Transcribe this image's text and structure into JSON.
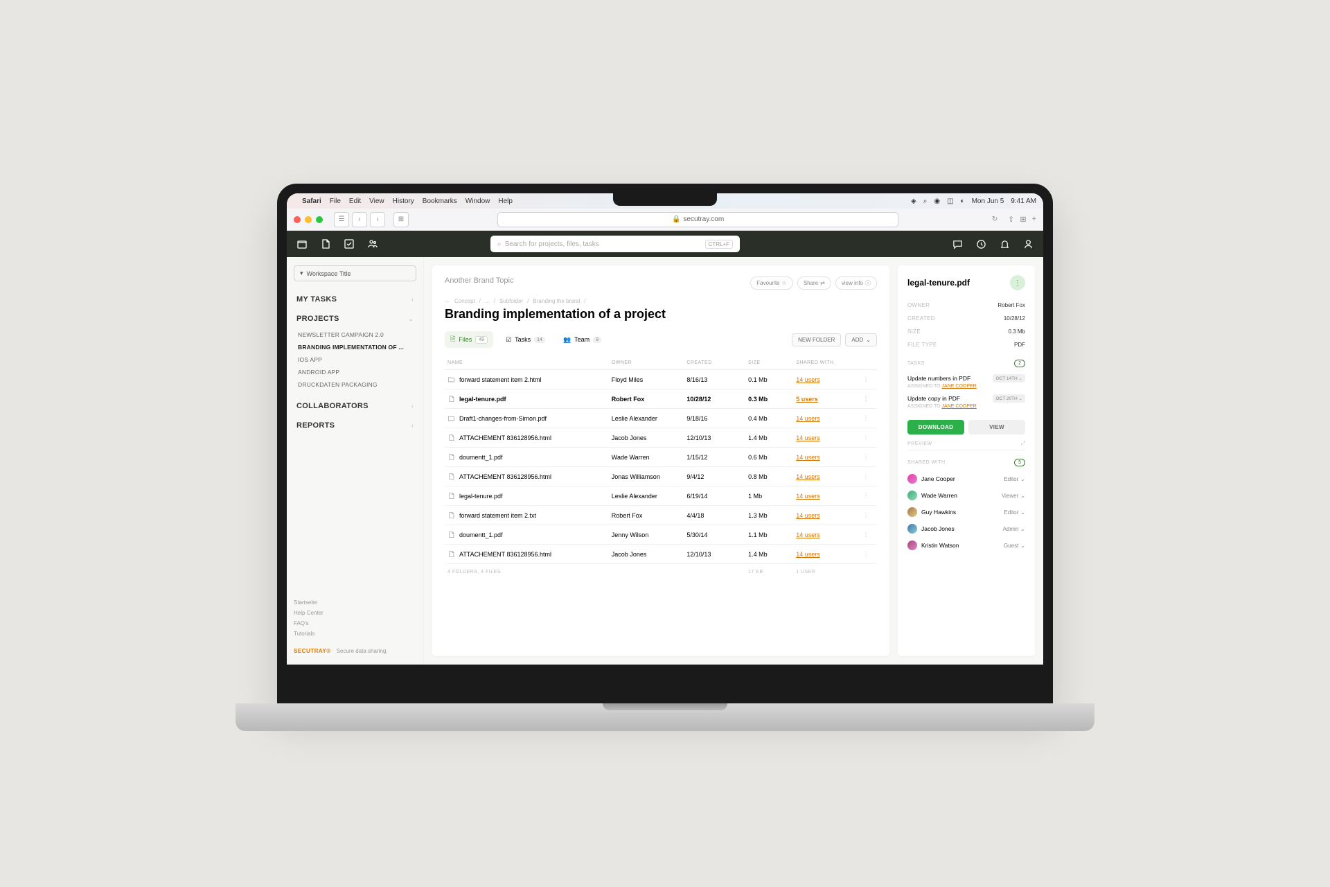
{
  "mac_menubar": {
    "app": "Safari",
    "items": [
      "File",
      "Edit",
      "View",
      "History",
      "Bookmarks",
      "Window",
      "Help"
    ],
    "date": "Mon Jun 5",
    "time": "9:41 AM"
  },
  "safari": {
    "url": "secutray.com"
  },
  "header": {
    "search_placeholder": "Search for projects, files, tasks",
    "search_kbd": "CTRL+F"
  },
  "sidebar": {
    "workspace": "Workspace Title",
    "sections": {
      "my_tasks": "MY TASKS",
      "projects": "PROJECTS",
      "collaborators": "COLLABORATORS",
      "reports": "REPORTS"
    },
    "projects": [
      "NEWSLETTER CAMPAIGN 2.0",
      "BRANDING IMPLEMENTATION OF ...",
      "IOS APP",
      "ANDROID APP",
      "DRUCKDATEN PACKAGING"
    ],
    "footer": {
      "items": [
        "Startseite",
        "Help Center",
        "FAQ's",
        "Tutorials"
      ]
    },
    "brand": "SECUTRAY®",
    "brand_tag": "Secure data sharing."
  },
  "content": {
    "topic": "Another Brand Topic",
    "actions": {
      "favourite": "Favourite",
      "share": "Share",
      "view_info": "view info"
    },
    "breadcrumb": [
      "Concept",
      "...",
      "Subfolder",
      "Branding the brand"
    ],
    "title": "Branding implementation of a project",
    "tabs": {
      "files": {
        "label": "Files",
        "count": "49"
      },
      "tasks": {
        "label": "Tasks",
        "count": "14"
      },
      "team": {
        "label": "Team",
        "count": "8"
      }
    },
    "buttons": {
      "new_folder": "NEW FOLDER",
      "add": "ADD"
    },
    "table": {
      "headers": [
        "NAME",
        "OWNER",
        "CREATED",
        "SIZE",
        "SHARED WITH"
      ],
      "rows": [
        {
          "type": "folder",
          "name": "forward statement item 2.html",
          "owner": "Floyd Miles",
          "created": "8/16/13",
          "size": "0.1 Mb",
          "shared": "14 users"
        },
        {
          "type": "file",
          "name": "legal-tenure.pdf",
          "owner": "Robert Fox",
          "created": "10/28/12",
          "size": "0.3 Mb",
          "shared": "5 users",
          "selected": true
        },
        {
          "type": "folder",
          "name": "Draft1-changes-from-Simon.pdf",
          "owner": "Leslie Alexander",
          "created": "9/18/16",
          "size": "0.4 Mb",
          "shared": "14 users"
        },
        {
          "type": "file",
          "name": "ATTACHEMENT 836128956.html",
          "owner": "Jacob Jones",
          "created": "12/10/13",
          "size": "1.4 Mb",
          "shared": "14 users"
        },
        {
          "type": "file",
          "name": "doumentt_1.pdf",
          "owner": "Wade Warren",
          "created": "1/15/12",
          "size": "0.6 Mb",
          "shared": "14 users"
        },
        {
          "type": "file",
          "name": "ATTACHEMENT 836128956.html",
          "owner": "Jonas Williamson",
          "created": "9/4/12",
          "size": "0.8 Mb",
          "shared": "14 users"
        },
        {
          "type": "file",
          "name": "legal-tenure.pdf",
          "owner": "Leslie Alexander",
          "created": "6/19/14",
          "size": "1 Mb",
          "shared": "14 users"
        },
        {
          "type": "file",
          "name": "forward statement item 2.txt",
          "owner": "Robert Fox",
          "created": "4/4/18",
          "size": "1.3 Mb",
          "shared": "14 users"
        },
        {
          "type": "file",
          "name": "doumentt_1.pdf",
          "owner": "Jenny Wilson",
          "created": "5/30/14",
          "size": "1.1 Mb",
          "shared": "14 users"
        },
        {
          "type": "file",
          "name": "ATTACHEMENT 836128956.html",
          "owner": "Jacob Jones",
          "created": "12/10/13",
          "size": "1.4 Mb",
          "shared": "14 users"
        }
      ],
      "footer": {
        "folders": "4 FOLDERS, 4 FILES",
        "size": "17 KB",
        "user": "1 USER"
      }
    }
  },
  "details": {
    "title": "legal-tenure.pdf",
    "meta": {
      "owner_label": "OWNER",
      "owner": "Robert Fox",
      "created_label": "CREATED",
      "created": "10/28/12",
      "size_label": "SIZE",
      "size": "0.3 Mb",
      "filetype_label": "FILE TYPE",
      "filetype": "PDF"
    },
    "tasks_label": "TASKS",
    "tasks_count": "2",
    "tasks": [
      {
        "title": "Update numbers in PDF",
        "date": "OCT 14TH",
        "assignee": "JANE COOPER"
      },
      {
        "title": "Update copy in PDF",
        "date": "OCT 20TH",
        "assignee": "JANE COOPER"
      }
    ],
    "assigned_to_label": "ASSIGNED TO",
    "download": "DOWNLOAD",
    "view": "VIEW",
    "preview_label": "PREVIEW",
    "shared_label": "SHARED WITH",
    "shared_count": "5",
    "shared": [
      {
        "name": "Jane Cooper",
        "role": "Editor"
      },
      {
        "name": "Wade Warren",
        "role": "Viewer"
      },
      {
        "name": "Guy Hawkins",
        "role": "Editor"
      },
      {
        "name": "Jacob Jones",
        "role": "Admin"
      },
      {
        "name": "Kristin Watson",
        "role": "Guest"
      }
    ]
  }
}
